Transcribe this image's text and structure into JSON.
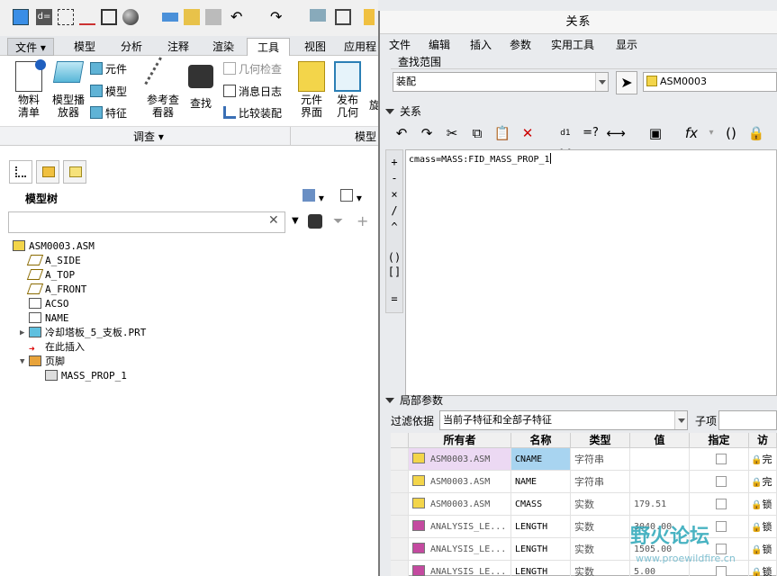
{
  "ribbon": {
    "tabs": [
      "文件",
      "模型",
      "分析",
      "注释",
      "渲染",
      "工具",
      "视图",
      "应用程"
    ],
    "active_tab": "工具",
    "buttons": {
      "bom": "物料\n清单",
      "model_player": "模型播\n放器",
      "component": "元件",
      "model": "模型",
      "feature": "特征",
      "reference_viewer": "参考查\n看器",
      "find": "查找",
      "geometry_check": "几何检查",
      "message_log": "消息日志",
      "compare_assembly": "比较装配",
      "component_interface": "元件\n界面",
      "publish_geometry": "发布\n几何"
    },
    "groups": {
      "investigate": "调查",
      "model_intent": "模型"
    }
  },
  "left_panel": {
    "title": "模型树",
    "search_placeholder": "",
    "tree": [
      {
        "label": "ASM0003.ASM",
        "indent": 0,
        "icon": "assembly-icon"
      },
      {
        "label": "A_SIDE",
        "indent": 1,
        "icon": "datum-plane-icon"
      },
      {
        "label": "A_TOP",
        "indent": 1,
        "icon": "datum-plane-icon"
      },
      {
        "label": "A_FRONT",
        "indent": 1,
        "icon": "datum-plane-icon"
      },
      {
        "label": "ACSO",
        "indent": 1,
        "icon": "csys-icon"
      },
      {
        "label": "NAME",
        "indent": 1,
        "icon": "annotation-icon"
      },
      {
        "label": "冷却塔板_5_支板.PRT",
        "indent": 1,
        "icon": "part-icon",
        "expandable": true
      },
      {
        "label": "在此插入",
        "indent": 1,
        "icon": "insert-here-icon"
      },
      {
        "label": "页脚",
        "indent": 1,
        "icon": "footer-icon",
        "expanded": true
      },
      {
        "label": "MASS_PROP_1",
        "indent": 2,
        "icon": "analysis-feature-icon"
      }
    ]
  },
  "dialog": {
    "title": "关系",
    "menu": [
      "文件",
      "编辑",
      "插入",
      "参数",
      "实用工具",
      "显示"
    ],
    "find_scope_label": "查找范围",
    "scope_type": "装配",
    "scope_object": "ASM0003",
    "relations_label": "关系",
    "operators": [
      "+",
      "-",
      "×",
      "/",
      "^",
      "()",
      "[]",
      "="
    ],
    "relation_text": "cmass=MASS:FID_MASS_PROP_1",
    "local_params_label": "局部参数",
    "filter_label": "过滤依据",
    "filter_value": "当前子特征和全部子特征",
    "child_label": "子项",
    "table": {
      "headers": [
        "所有者",
        "名称",
        "类型",
        "值",
        "指定",
        "访"
      ],
      "rows": [
        {
          "owner": "ASM0003.ASM",
          "name": "CNAME",
          "type": "字符串",
          "value": "",
          "access": "完"
        },
        {
          "owner": "ASM0003.ASM",
          "name": "NAME",
          "type": "字符串",
          "value": "",
          "access": "完"
        },
        {
          "owner": "ASM0003.ASM",
          "name": "CMASS",
          "type": "实数",
          "value": "179.51",
          "access": "锁"
        },
        {
          "owner": "ANALYSIS_LE...",
          "name": "LENGTH",
          "type": "实数",
          "value": "3040.00",
          "access": "锁"
        },
        {
          "owner": "ANALYSIS_LE...",
          "name": "LENGTH",
          "type": "实数",
          "value": "1505.00",
          "access": "锁"
        },
        {
          "owner": "ANALYSIS_LE...",
          "name": "LENGTH",
          "type": "实数",
          "value": "5.00",
          "access": "锁"
        }
      ]
    }
  },
  "watermark": {
    "title": "野火论坛",
    "url": "www.proewildfire.cn"
  }
}
